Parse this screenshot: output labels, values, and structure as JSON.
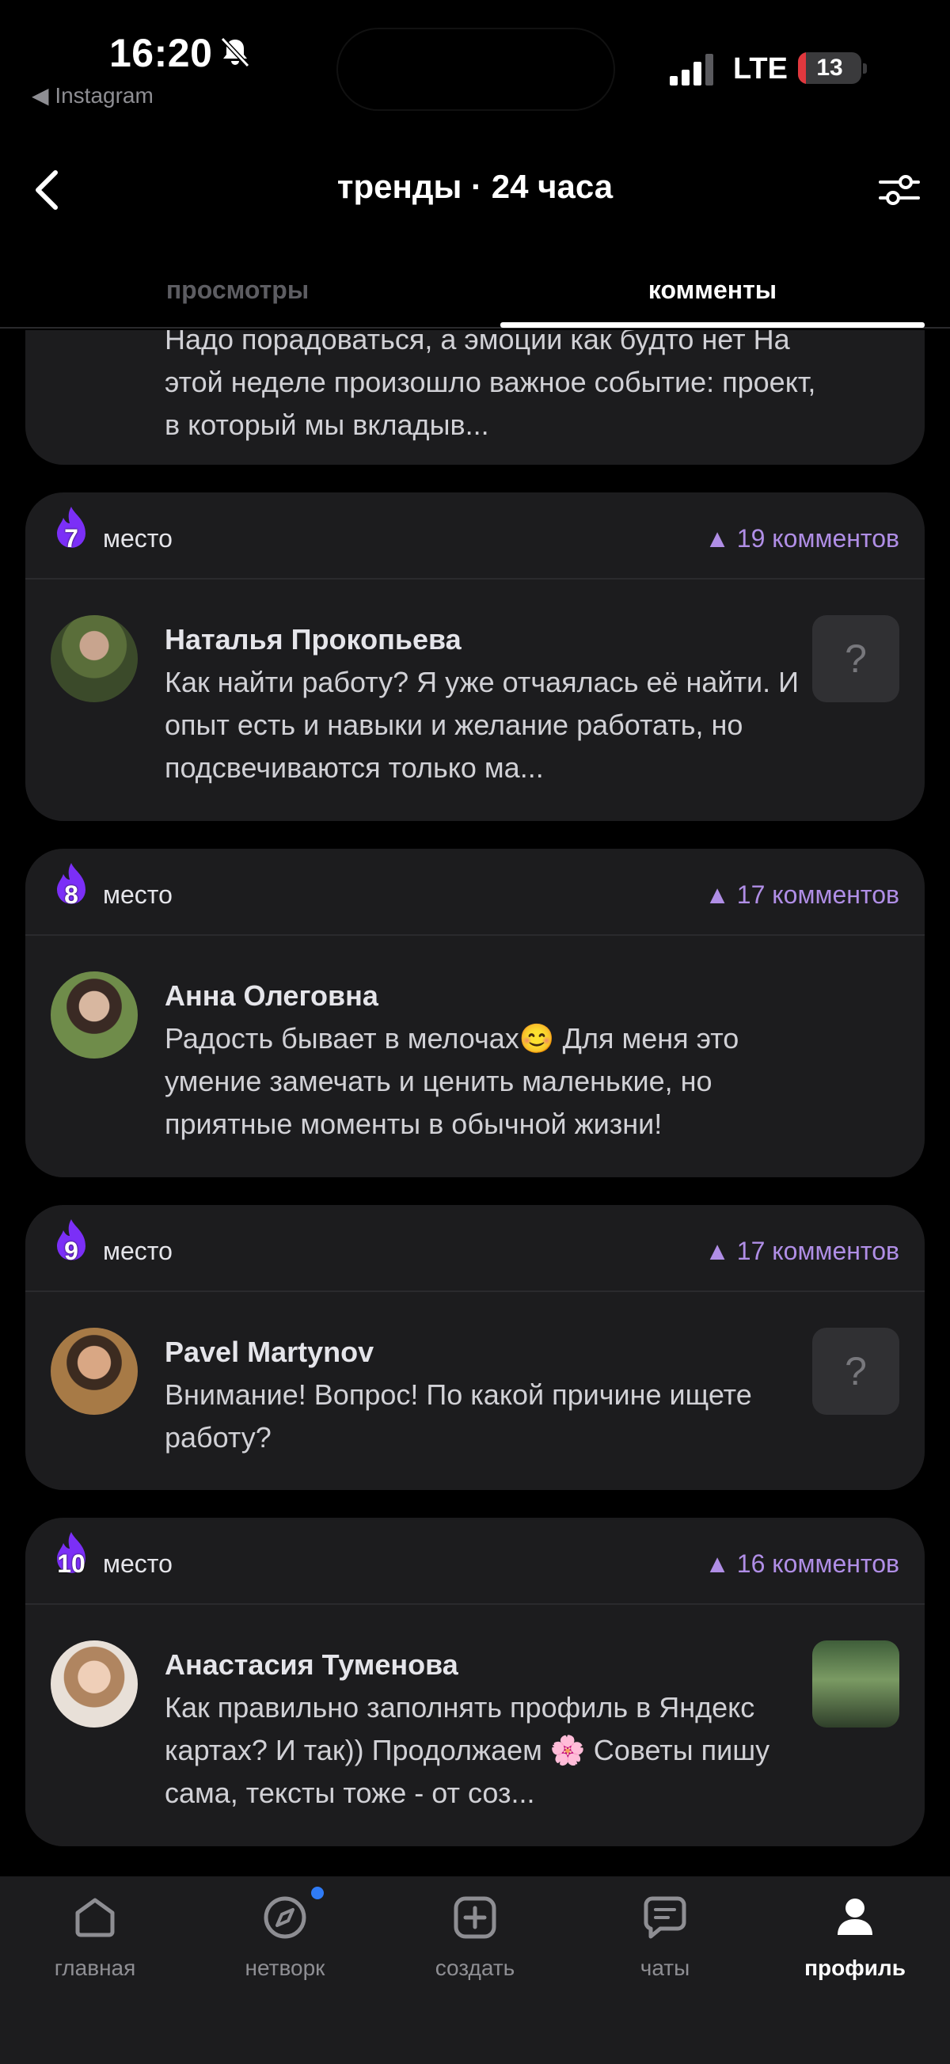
{
  "status_bar": {
    "time": "16:20",
    "back_app": "◀ Instagram",
    "network": "LTE",
    "battery": "13",
    "battery_level": 0.13
  },
  "header": {
    "title": "тренды · 24 часа"
  },
  "tabs": [
    {
      "label": "просмотры",
      "active": false
    },
    {
      "label": "комменты",
      "active": true
    }
  ],
  "partial_card": {
    "text": "Надо порадоваться, а эмоции как будто нет На этой неделе произошло важное событие: проект, в который мы вкладыв..."
  },
  "entries": [
    {
      "rank": "7",
      "place_label": "место",
      "comments": "19 комментов",
      "author": "Наталья Прокопьева",
      "text": "Как найти работу? Я уже отчаялась её найти. И опыт есть и навыки и желание работать, но подсвечиваются только ма...",
      "thumb": "?"
    },
    {
      "rank": "8",
      "place_label": "место",
      "comments": "17 комментов",
      "author": "Анна Олеговна",
      "text": "Радость бывает в мелочах😊 Для меня это умение замечать и ценить маленькие, но приятные моменты в обычной жизни!",
      "thumb": ""
    },
    {
      "rank": "9",
      "place_label": "место",
      "comments": "17 комментов",
      "author": "Pavel Martynov",
      "text": "Внимание! Вопрос! По какой причине ищете работу?",
      "thumb": "?"
    },
    {
      "rank": "10",
      "place_label": "место",
      "comments": "16 комментов",
      "author": "Анастасия Туменова",
      "text": "Как правильно заполнять профиль в Яндекс картах? И так)) Продолжаем 🌸 Советы пишу сама, тексты тоже - от соз...",
      "thumb": ""
    }
  ],
  "nav": [
    {
      "label": "главная",
      "icon": "home-icon"
    },
    {
      "label": "нетворк",
      "icon": "compass-icon"
    },
    {
      "label": "создать",
      "icon": "plus-square-icon"
    },
    {
      "label": "чаты",
      "icon": "chat-icon"
    },
    {
      "label": "профиль",
      "icon": "profile-icon",
      "active": true
    }
  ],
  "colors": {
    "accent": "#b08ee6",
    "flame": "#7b2ff7",
    "card": "#1c1c1e",
    "notification_dot": "#2f7bf6"
  }
}
